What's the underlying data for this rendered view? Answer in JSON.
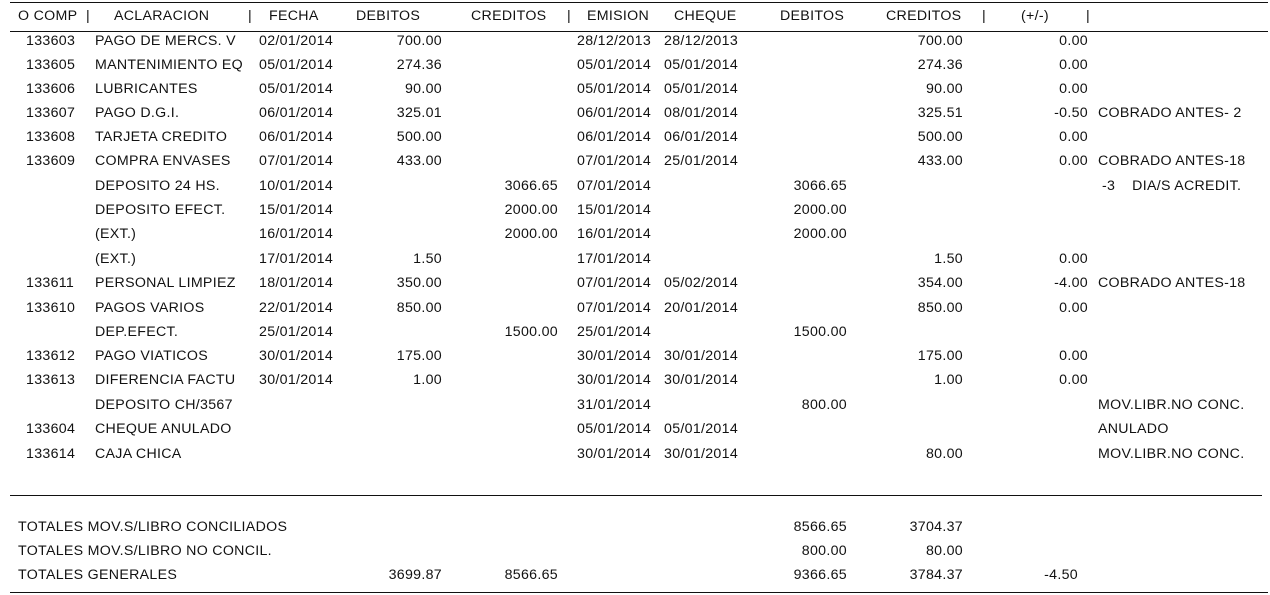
{
  "header": {
    "o_comp": "O COMP",
    "aclaracion": "ACLARACION",
    "fecha": "FECHA",
    "debitos_libro": "DEBITOS",
    "creditos_libro": "CREDITOS",
    "emision": "EMISION",
    "cheque": "CHEQUE",
    "debitos_banco": "DEBITOS",
    "creditos_banco": "CREDITOS",
    "diferencia": "(+/-)",
    "separator": "|"
  },
  "rows": [
    {
      "comp": "133603",
      "aclaracion": "PAGO DE MERCS. V",
      "fecha": "02/01/2014",
      "debito": "700.00",
      "credito": "",
      "emision": "28/12/2013",
      "cheque": "28/12/2013",
      "debito_b": "",
      "credito_b": "700.00",
      "dif": "0.00",
      "obs": ""
    },
    {
      "comp": "133605",
      "aclaracion": "MANTENIMIENTO EQ",
      "fecha": "05/01/2014",
      "debito": "274.36",
      "credito": "",
      "emision": "05/01/2014",
      "cheque": "05/01/2014",
      "debito_b": "",
      "credito_b": "274.36",
      "dif": "0.00",
      "obs": ""
    },
    {
      "comp": "133606",
      "aclaracion": "LUBRICANTES",
      "fecha": "05/01/2014",
      "debito": "90.00",
      "credito": "",
      "emision": "05/01/2014",
      "cheque": "05/01/2014",
      "debito_b": "",
      "credito_b": "90.00",
      "dif": "0.00",
      "obs": ""
    },
    {
      "comp": "133607",
      "aclaracion": "PAGO D.G.I.",
      "fecha": "06/01/2014",
      "debito": "325.01",
      "credito": "",
      "emision": "06/01/2014",
      "cheque": "08/01/2014",
      "debito_b": "",
      "credito_b": "325.51",
      "dif": "-0.50",
      "obs": "COBRADO ANTES- 2"
    },
    {
      "comp": "133608",
      "aclaracion": "TARJETA CREDITO",
      "fecha": "06/01/2014",
      "debito": "500.00",
      "credito": "",
      "emision": "06/01/2014",
      "cheque": "06/01/2014",
      "debito_b": "",
      "credito_b": "500.00",
      "dif": "0.00",
      "obs": ""
    },
    {
      "comp": "133609",
      "aclaracion": "COMPRA ENVASES",
      "fecha": "07/01/2014",
      "debito": "433.00",
      "credito": "",
      "emision": "07/01/2014",
      "cheque": "25/01/2014",
      "debito_b": "",
      "credito_b": "433.00",
      "dif": "0.00",
      "obs": "COBRADO ANTES-18"
    },
    {
      "comp": "",
      "aclaracion": "DEPOSITO 24 HS.",
      "fecha": "10/01/2014",
      "debito": "",
      "credito": "3066.65",
      "emision": "07/01/2014",
      "cheque": "",
      "debito_b": "3066.65",
      "credito_b": "",
      "dif": "",
      "obs": "-3    DIA/S ACREDIT."
    },
    {
      "comp": "",
      "aclaracion": "DEPOSITO EFECT.",
      "fecha": "15/01/2014",
      "debito": "",
      "credito": "2000.00",
      "emision": "15/01/2014",
      "cheque": "",
      "debito_b": "2000.00",
      "credito_b": "",
      "dif": "",
      "obs": ""
    },
    {
      "comp": "",
      "aclaracion": "(EXT.)",
      "fecha": "16/01/2014",
      "debito": "",
      "credito": "2000.00",
      "emision": "16/01/2014",
      "cheque": "",
      "debito_b": "2000.00",
      "credito_b": "",
      "dif": "",
      "obs": ""
    },
    {
      "comp": "",
      "aclaracion": "(EXT.)",
      "fecha": "17/01/2014",
      "debito": "1.50",
      "credito": "",
      "emision": "17/01/2014",
      "cheque": "",
      "debito_b": "",
      "credito_b": "1.50",
      "dif": "0.00",
      "obs": ""
    },
    {
      "comp": "133611",
      "aclaracion": "PERSONAL LIMPIEZ",
      "fecha": "18/01/2014",
      "debito": "350.00",
      "credito": "",
      "emision": "07/01/2014",
      "cheque": "05/02/2014",
      "debito_b": "",
      "credito_b": "354.00",
      "dif": "-4.00",
      "obs": "COBRADO ANTES-18"
    },
    {
      "comp": "133610",
      "aclaracion": "PAGOS VARIOS",
      "fecha": "22/01/2014",
      "debito": "850.00",
      "credito": "",
      "emision": "07/01/2014",
      "cheque": "20/01/2014",
      "debito_b": "",
      "credito_b": "850.00",
      "dif": "0.00",
      "obs": ""
    },
    {
      "comp": "",
      "aclaracion": "DEP.EFECT.",
      "fecha": "25/01/2014",
      "debito": "",
      "credito": "1500.00",
      "emision": "25/01/2014",
      "cheque": "",
      "debito_b": "1500.00",
      "credito_b": "",
      "dif": "",
      "obs": ""
    },
    {
      "comp": "133612",
      "aclaracion": "PAGO VIATICOS",
      "fecha": "30/01/2014",
      "debito": "175.00",
      "credito": "",
      "emision": "30/01/2014",
      "cheque": "30/01/2014",
      "debito_b": "",
      "credito_b": "175.00",
      "dif": "0.00",
      "obs": ""
    },
    {
      "comp": "133613",
      "aclaracion": "DIFERENCIA FACTU",
      "fecha": "30/01/2014",
      "debito": "1.00",
      "credito": "",
      "emision": "30/01/2014",
      "cheque": "30/01/2014",
      "debito_b": "",
      "credito_b": "1.00",
      "dif": "0.00",
      "obs": ""
    },
    {
      "comp": "",
      "aclaracion": "DEPOSITO CH/3567",
      "fecha": "",
      "debito": "",
      "credito": "",
      "emision": "31/01/2014",
      "cheque": "",
      "debito_b": "800.00",
      "credito_b": "",
      "dif": "",
      "obs": "MOV.LIBR.NO CONC."
    },
    {
      "comp": "133604",
      "aclaracion": "CHEQUE ANULADO",
      "fecha": "",
      "debito": "",
      "credito": "",
      "emision": "05/01/2014",
      "cheque": "05/01/2014",
      "debito_b": "",
      "credito_b": "",
      "dif": "",
      "obs": "ANULADO"
    },
    {
      "comp": "133614",
      "aclaracion": "CAJA CHICA",
      "fecha": "",
      "debito": "",
      "credito": "",
      "emision": "30/01/2014",
      "cheque": "30/01/2014",
      "debito_b": "",
      "credito_b": "80.00",
      "dif": "",
      "obs": "MOV.LIBR.NO CONC."
    }
  ],
  "totals": [
    {
      "label": "TOTALES MOV.S/LIBRO CONCILIADOS",
      "debito": "",
      "credito": "",
      "debito_b": "8566.65",
      "credito_b": "3704.37",
      "dif": ""
    },
    {
      "label": "TOTALES MOV.S/LIBRO NO CONCIL.",
      "debito": "",
      "credito": "",
      "debito_b": "800.00",
      "credito_b": "80.00",
      "dif": ""
    },
    {
      "label": "TOTALES GENERALES",
      "debito": "3699.87",
      "credito": "8566.65",
      "debito_b": "9366.65",
      "credito_b": "3784.37",
      "dif": "-4.50"
    }
  ]
}
